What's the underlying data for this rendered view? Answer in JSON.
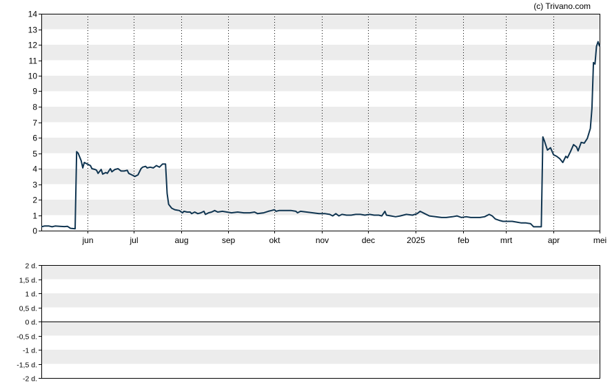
{
  "credit": "(c) Trivano.com",
  "chart_data": [
    {
      "type": "line",
      "ylim": [
        0,
        14
      ],
      "yticks": [
        "0",
        "1",
        "2",
        "3",
        "4",
        "5",
        "6",
        "7",
        "8",
        "9",
        "10",
        "11",
        "12",
        "13",
        "14"
      ],
      "xlim": [
        "2024-05-02",
        "2025-05-01"
      ],
      "month_ticks": [
        {
          "date": "2024-06-01",
          "label": "jun"
        },
        {
          "date": "2024-07-01",
          "label": "jul"
        },
        {
          "date": "2024-08-01",
          "label": "aug"
        },
        {
          "date": "2024-09-01",
          "label": "sep"
        },
        {
          "date": "2024-10-01",
          "label": "okt"
        },
        {
          "date": "2024-11-01",
          "label": "nov"
        },
        {
          "date": "2024-12-01",
          "label": "dec"
        },
        {
          "date": "2025-01-01",
          "label": "2025"
        },
        {
          "date": "2025-02-01",
          "label": "feb"
        },
        {
          "date": "2025-03-01",
          "label": "mrt"
        },
        {
          "date": "2025-04-01",
          "label": "apr"
        },
        {
          "date": "2025-05-01",
          "label": "mei"
        }
      ],
      "grid": true,
      "series": [
        {
          "color": "#0f3450",
          "points": [
            [
              "2024-05-02",
              0.25
            ],
            [
              "2024-05-04",
              0.3
            ],
            [
              "2024-05-07",
              0.3
            ],
            [
              "2024-05-09",
              0.25
            ],
            [
              "2024-05-11",
              0.3
            ],
            [
              "2024-05-14",
              0.28
            ],
            [
              "2024-05-17",
              0.26
            ],
            [
              "2024-05-19",
              0.28
            ],
            [
              "2024-05-21",
              0.15
            ],
            [
              "2024-05-24",
              0.12
            ],
            [
              "2024-05-25",
              5.1
            ],
            [
              "2024-05-26",
              5.0
            ],
            [
              "2024-05-28",
              4.5
            ],
            [
              "2024-05-29",
              4.05
            ],
            [
              "2024-05-30",
              4.4
            ],
            [
              "2024-06-01",
              4.3
            ],
            [
              "2024-06-03",
              4.2
            ],
            [
              "2024-06-04",
              4.0
            ],
            [
              "2024-06-06",
              3.95
            ],
            [
              "2024-06-07",
              3.9
            ],
            [
              "2024-06-08",
              3.7
            ],
            [
              "2024-06-10",
              3.95
            ],
            [
              "2024-06-11",
              3.65
            ],
            [
              "2024-06-13",
              3.75
            ],
            [
              "2024-06-14",
              3.7
            ],
            [
              "2024-06-16",
              4.0
            ],
            [
              "2024-06-17",
              3.8
            ],
            [
              "2024-06-19",
              3.95
            ],
            [
              "2024-06-21",
              4.0
            ],
            [
              "2024-06-23",
              3.85
            ],
            [
              "2024-06-25",
              3.85
            ],
            [
              "2024-06-27",
              3.9
            ],
            [
              "2024-06-28",
              3.7
            ],
            [
              "2024-06-30",
              3.6
            ],
            [
              "2024-07-02",
              3.5
            ],
            [
              "2024-07-04",
              3.6
            ],
            [
              "2024-07-06",
              4.0
            ],
            [
              "2024-07-07",
              4.1
            ],
            [
              "2024-07-09",
              4.15
            ],
            [
              "2024-07-10",
              4.05
            ],
            [
              "2024-07-12",
              4.1
            ],
            [
              "2024-07-14",
              4.05
            ],
            [
              "2024-07-16",
              4.2
            ],
            [
              "2024-07-18",
              4.1
            ],
            [
              "2024-07-20",
              4.3
            ],
            [
              "2024-07-22",
              4.3
            ],
            [
              "2024-07-23",
              2.4
            ],
            [
              "2024-07-24",
              1.7
            ],
            [
              "2024-07-26",
              1.45
            ],
            [
              "2024-07-28",
              1.35
            ],
            [
              "2024-07-31",
              1.3
            ],
            [
              "2024-08-02",
              1.15
            ],
            [
              "2024-08-03",
              1.25
            ],
            [
              "2024-08-05",
              1.2
            ],
            [
              "2024-08-07",
              1.2
            ],
            [
              "2024-08-08",
              1.1
            ],
            [
              "2024-08-10",
              1.2
            ],
            [
              "2024-08-12",
              1.1
            ],
            [
              "2024-08-14",
              1.15
            ],
            [
              "2024-08-16",
              1.25
            ],
            [
              "2024-08-17",
              1.05
            ],
            [
              "2024-08-19",
              1.15
            ],
            [
              "2024-08-21",
              1.2
            ],
            [
              "2024-08-23",
              1.3
            ],
            [
              "2024-08-25",
              1.2
            ],
            [
              "2024-08-28",
              1.25
            ],
            [
              "2024-08-31",
              1.2
            ],
            [
              "2024-09-03",
              1.15
            ],
            [
              "2024-09-07",
              1.2
            ],
            [
              "2024-09-11",
              1.15
            ],
            [
              "2024-09-15",
              1.15
            ],
            [
              "2024-09-18",
              1.2
            ],
            [
              "2024-09-20",
              1.1
            ],
            [
              "2024-09-24",
              1.15
            ],
            [
              "2024-09-27",
              1.25
            ],
            [
              "2024-09-29",
              1.3
            ],
            [
              "2024-10-01",
              1.35
            ],
            [
              "2024-10-02",
              1.25
            ],
            [
              "2024-10-04",
              1.3
            ],
            [
              "2024-10-08",
              1.3
            ],
            [
              "2024-10-12",
              1.3
            ],
            [
              "2024-10-15",
              1.25
            ],
            [
              "2024-10-16",
              1.15
            ],
            [
              "2024-10-18",
              1.25
            ],
            [
              "2024-10-22",
              1.2
            ],
            [
              "2024-10-26",
              1.15
            ],
            [
              "2024-10-30",
              1.1
            ],
            [
              "2024-11-03",
              1.1
            ],
            [
              "2024-11-06",
              1.05
            ],
            [
              "2024-11-08",
              0.95
            ],
            [
              "2024-11-10",
              1.1
            ],
            [
              "2024-11-12",
              0.95
            ],
            [
              "2024-11-14",
              1.05
            ],
            [
              "2024-11-17",
              1.0
            ],
            [
              "2024-11-20",
              1.0
            ],
            [
              "2024-11-23",
              1.05
            ],
            [
              "2024-11-26",
              1.05
            ],
            [
              "2024-11-29",
              1.0
            ],
            [
              "2024-12-02",
              1.05
            ],
            [
              "2024-12-05",
              1.0
            ],
            [
              "2024-12-08",
              1.0
            ],
            [
              "2024-12-10",
              0.95
            ],
            [
              "2024-12-12",
              1.25
            ],
            [
              "2024-12-13",
              1.0
            ],
            [
              "2024-12-16",
              0.95
            ],
            [
              "2024-12-19",
              0.9
            ],
            [
              "2024-12-22",
              0.95
            ],
            [
              "2024-12-26",
              1.05
            ],
            [
              "2024-12-30",
              1.0
            ],
            [
              "2025-01-02",
              1.1
            ],
            [
              "2025-01-04",
              1.25
            ],
            [
              "2025-01-07",
              1.1
            ],
            [
              "2025-01-10",
              0.95
            ],
            [
              "2025-01-14",
              0.9
            ],
            [
              "2025-01-18",
              0.85
            ],
            [
              "2025-01-21",
              0.85
            ],
            [
              "2025-01-25",
              0.9
            ],
            [
              "2025-01-28",
              0.95
            ],
            [
              "2025-01-31",
              0.85
            ],
            [
              "2025-02-03",
              0.9
            ],
            [
              "2025-02-06",
              0.85
            ],
            [
              "2025-02-09",
              0.85
            ],
            [
              "2025-02-12",
              0.85
            ],
            [
              "2025-02-15",
              0.9
            ],
            [
              "2025-02-18",
              1.05
            ],
            [
              "2025-02-20",
              0.95
            ],
            [
              "2025-02-22",
              0.75
            ],
            [
              "2025-02-25",
              0.65
            ],
            [
              "2025-02-27",
              0.6
            ],
            [
              "2025-03-02",
              0.6
            ],
            [
              "2025-03-05",
              0.6
            ],
            [
              "2025-03-08",
              0.55
            ],
            [
              "2025-03-11",
              0.5
            ],
            [
              "2025-03-14",
              0.5
            ],
            [
              "2025-03-17",
              0.45
            ],
            [
              "2025-03-19",
              0.25
            ],
            [
              "2025-03-22",
              0.25
            ],
            [
              "2025-03-24",
              0.25
            ],
            [
              "2025-03-25",
              6.05
            ],
            [
              "2025-03-26",
              5.8
            ],
            [
              "2025-03-28",
              5.2
            ],
            [
              "2025-03-30",
              5.35
            ],
            [
              "2025-04-01",
              4.9
            ],
            [
              "2025-04-03",
              4.8
            ],
            [
              "2025-04-05",
              4.65
            ],
            [
              "2025-04-07",
              4.4
            ],
            [
              "2025-04-09",
              4.8
            ],
            [
              "2025-04-10",
              4.7
            ],
            [
              "2025-04-12",
              5.1
            ],
            [
              "2025-04-14",
              5.55
            ],
            [
              "2025-04-16",
              5.4
            ],
            [
              "2025-04-17",
              5.15
            ],
            [
              "2025-04-19",
              5.7
            ],
            [
              "2025-04-21",
              5.65
            ],
            [
              "2025-04-23",
              5.95
            ],
            [
              "2025-04-25",
              6.6
            ],
            [
              "2025-04-26",
              7.9
            ],
            [
              "2025-04-27",
              10.85
            ],
            [
              "2025-04-28",
              10.75
            ],
            [
              "2025-04-29",
              11.9
            ],
            [
              "2025-04-30",
              12.2
            ],
            [
              "2025-05-01",
              11.9
            ]
          ]
        }
      ]
    },
    {
      "type": "line",
      "ylim": [
        -2,
        2
      ],
      "yticks": [
        "-2 d.",
        "-1,5 d.",
        "-1 d.",
        "-0,5 d.",
        "0 d.",
        "0,5 d.",
        "1 d.",
        "1,5 d.",
        "2 d."
      ],
      "grid": true,
      "series": []
    }
  ]
}
